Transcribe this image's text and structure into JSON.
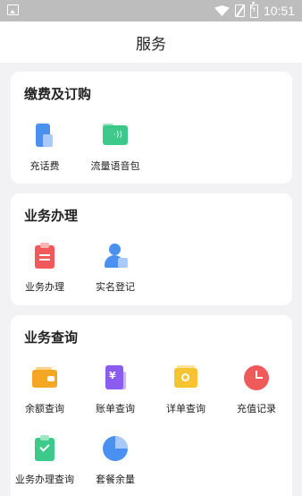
{
  "status_bar": {
    "time": "10:51",
    "icons": [
      "image-icon",
      "wifi-icon",
      "no-sim-icon",
      "battery-charging-icon"
    ]
  },
  "header": {
    "title": "服务"
  },
  "sections": [
    {
      "title": "缴费及订购",
      "items": [
        {
          "label": "充话费",
          "icon": "phone-recharge-icon"
        },
        {
          "label": "流量语音包",
          "icon": "data-voice-package-icon"
        }
      ]
    },
    {
      "title": "业务办理",
      "items": [
        {
          "label": "业务办理",
          "icon": "clipboard-icon"
        },
        {
          "label": "实名登记",
          "icon": "user-id-icon"
        }
      ]
    },
    {
      "title": "业务查询",
      "items": [
        {
          "label": "余额查询",
          "icon": "wallet-icon"
        },
        {
          "label": "账单查询",
          "icon": "bill-icon"
        },
        {
          "label": "详单查询",
          "icon": "detail-search-icon"
        },
        {
          "label": "充值记录",
          "icon": "clock-icon"
        },
        {
          "label": "业务办理查询",
          "icon": "checklist-icon"
        },
        {
          "label": "套餐余量",
          "icon": "pie-chart-icon"
        }
      ]
    }
  ],
  "colors": {
    "background": "#f2f2f4",
    "card": "#ffffff",
    "blue": "#4a90f0",
    "green": "#3cc98a",
    "red": "#f05a5a",
    "orange": "#f5a623",
    "purple": "#8a5cf0",
    "yellow": "#f7c431"
  }
}
